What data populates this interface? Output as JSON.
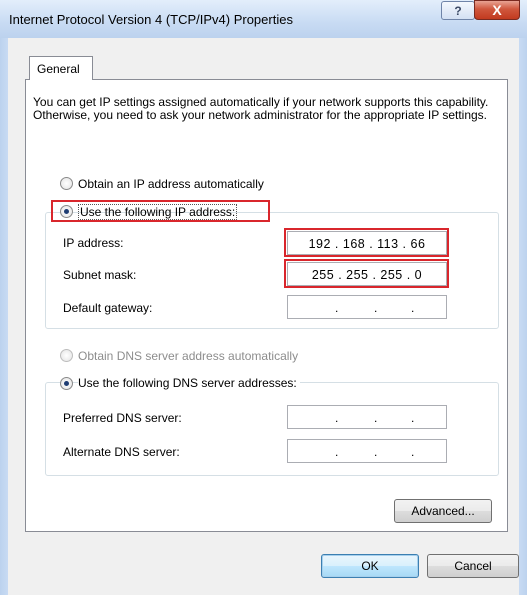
{
  "window": {
    "title": "Internet Protocol Version 4 (TCP/IPv4) Properties",
    "help_label": "?",
    "close_label": "X"
  },
  "tabs": [
    {
      "label": "General",
      "selected": true
    }
  ],
  "intro_text": "You can get IP settings assigned automatically if your network supports this capability. Otherwise, you need to ask your network administrator for the appropriate IP settings.",
  "ip_mode": {
    "auto_label": "Obtain an IP address automatically",
    "manual_label": "Use the following IP address:",
    "selected": "manual"
  },
  "ip_fields": [
    {
      "label": "IP address:",
      "value": "192 . 168 . 113 . 66"
    },
    {
      "label": "Subnet mask:",
      "value": "255 . 255 . 255 .  0"
    },
    {
      "label": "Default gateway:",
      "value": ""
    }
  ],
  "dns_mode": {
    "auto_label": "Obtain DNS server address automatically",
    "manual_label": "Use the following DNS server addresses:",
    "selected": "manual",
    "auto_enabled": false
  },
  "dns_fields": [
    {
      "label": "Preferred DNS server:",
      "value": ""
    },
    {
      "label": "Alternate DNS server:",
      "value": ""
    }
  ],
  "buttons": {
    "advanced": "Advanced...",
    "ok": "OK",
    "cancel": "Cancel"
  },
  "colors": {
    "highlight": "#d9262c",
    "radio_selected": "#1f3d73",
    "disabled_text": "#8d8d8d"
  }
}
